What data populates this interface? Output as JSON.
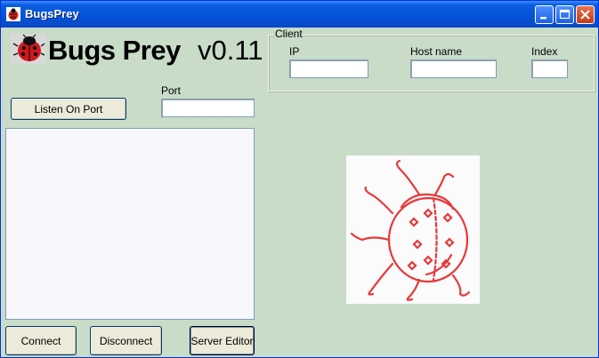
{
  "window": {
    "title": "BugsPrey"
  },
  "header": {
    "app_name": "Bugs Prey",
    "version": "v0.11"
  },
  "client_group": {
    "legend": "Client",
    "ip_label": "IP",
    "ip_value": "",
    "hostname_label": "Host name",
    "hostname_value": "",
    "index_label": "Index",
    "index_value": ""
  },
  "listener": {
    "listen_button": "Listen On Port",
    "port_label": "Port",
    "port_value": ""
  },
  "footer": {
    "connect": "Connect",
    "disconnect": "Disconnect",
    "server_editor": "Server Editor"
  },
  "icons": {
    "app_icon": "ladybug-icon",
    "logo": "ladybug-icon",
    "illustration": "ladybug-drawing",
    "minimize": "minimize-icon",
    "maximize": "maximize-icon",
    "close": "close-icon"
  },
  "colors": {
    "titlebar": "#0453d8",
    "client_bg": "#c8dcc8",
    "accent_red": "#e03030"
  }
}
